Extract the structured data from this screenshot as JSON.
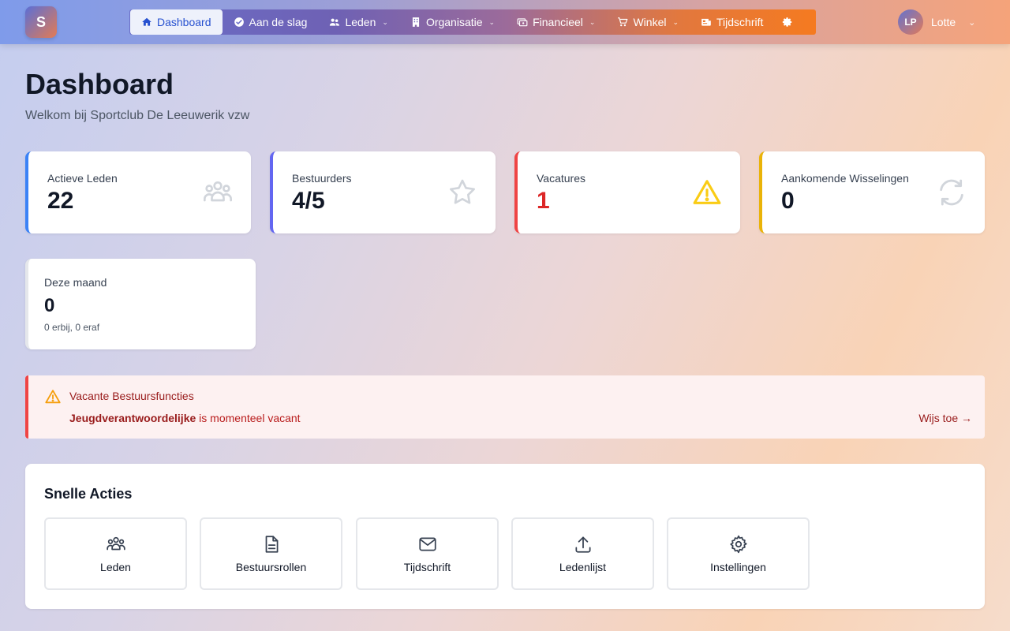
{
  "app": {
    "logo_letter": "S"
  },
  "nav": {
    "items": [
      {
        "label": "Dashboard"
      },
      {
        "label": "Aan de slag"
      },
      {
        "label": "Leden"
      },
      {
        "label": "Organisatie"
      },
      {
        "label": "Financieel"
      },
      {
        "label": "Winkel"
      },
      {
        "label": "Tijdschrift"
      }
    ]
  },
  "user": {
    "initials": "LP",
    "name": "Lotte"
  },
  "header": {
    "title": "Dashboard",
    "subtitle": "Welkom bij Sportclub De Leeuwerik vzw"
  },
  "stats": [
    {
      "label": "Actieve Leden",
      "value": "22",
      "accent": "#3b82f6",
      "icon": "users-icon"
    },
    {
      "label": "Bestuurders",
      "value": "4/5",
      "accent": "#6366f1",
      "icon": "star-icon"
    },
    {
      "label": "Vacatures",
      "value": "1",
      "accent": "#ef4444",
      "value_color": "#dc2626",
      "icon": "warning-icon"
    },
    {
      "label": "Aankomende Wisselingen",
      "value": "0",
      "accent": "#eab308",
      "icon": "refresh-icon"
    }
  ],
  "month": {
    "label": "Deze maand",
    "value": "0",
    "sub": "0 erbij, 0 eraf"
  },
  "alert": {
    "title": "Vacante Bestuursfuncties",
    "role": "Jeugdverantwoordelijke",
    "text": " is momenteel vacant",
    "link": "Wijs toe →"
  },
  "quick_actions": {
    "title": "Snelle Acties",
    "items": [
      {
        "label": "Leden",
        "icon": "users-icon"
      },
      {
        "label": "Bestuursrollen",
        "icon": "document-icon"
      },
      {
        "label": "Tijdschrift",
        "icon": "mail-icon"
      },
      {
        "label": "Ledenlijst",
        "icon": "upload-icon"
      },
      {
        "label": "Instellingen",
        "icon": "gear-icon"
      }
    ]
  }
}
